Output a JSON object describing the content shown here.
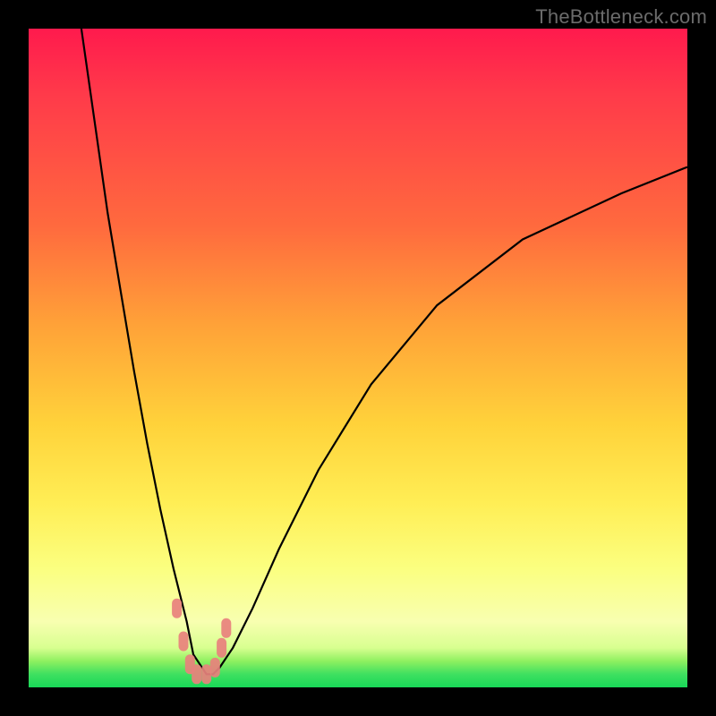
{
  "watermark": "TheBottleneck.com",
  "chart_data": {
    "type": "line",
    "title": "",
    "xlabel": "",
    "ylabel": "",
    "xlim": [
      0,
      100
    ],
    "ylim": [
      0,
      100
    ],
    "grid": false,
    "legend": false,
    "series": [
      {
        "name": "bottleneck-curve",
        "x": [
          8,
          10,
          12,
          14,
          16,
          18,
          20,
          22,
          24,
          25,
          27,
          28,
          29,
          31,
          34,
          38,
          44,
          52,
          62,
          75,
          90,
          100
        ],
        "values": [
          100,
          86,
          72,
          60,
          48,
          37,
          27,
          18,
          10,
          5,
          2,
          2,
          3,
          6,
          12,
          21,
          33,
          46,
          58,
          68,
          75,
          79
        ]
      }
    ],
    "markers": [
      {
        "x": 22.5,
        "y": 12
      },
      {
        "x": 23.5,
        "y": 7
      },
      {
        "x": 24.5,
        "y": 3.5
      },
      {
        "x": 25.5,
        "y": 2
      },
      {
        "x": 27.0,
        "y": 2
      },
      {
        "x": 28.3,
        "y": 3
      },
      {
        "x": 29.3,
        "y": 6
      },
      {
        "x": 30.0,
        "y": 9
      }
    ],
    "colors": {
      "curve": "#000000",
      "markers": "#e8817d",
      "gradient_top": "#ff1a4d",
      "gradient_bottom": "#18d858"
    }
  }
}
